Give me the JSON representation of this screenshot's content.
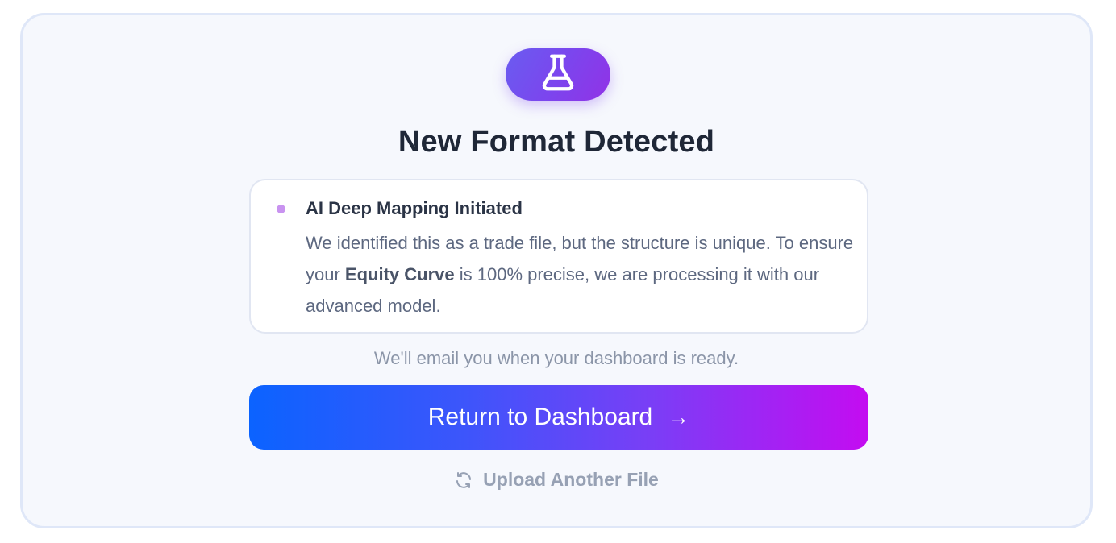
{
  "dialog": {
    "title": "New Format Detected",
    "icon": "flask-icon",
    "accent_gradient": [
      "#6a5cf0",
      "#9132e6"
    ]
  },
  "info": {
    "heading": "AI Deep Mapping Initiated",
    "body_part1": "We identified this as a trade file, but the structure is unique. To ensure your ",
    "body_bold": "Equity Curve",
    "body_part2": " is 100% precise, we are processing it with our advanced model.",
    "dot_color": "#c993f0"
  },
  "email_note": "We'll email you when your dashboard is ready.",
  "primary_button": {
    "label": "Return to Dashboard",
    "arrow": "→",
    "gradient": [
      "#0b63ff",
      "#c40cf1"
    ]
  },
  "secondary_action": {
    "label": "Upload Another File",
    "icon": "refresh-icon"
  }
}
